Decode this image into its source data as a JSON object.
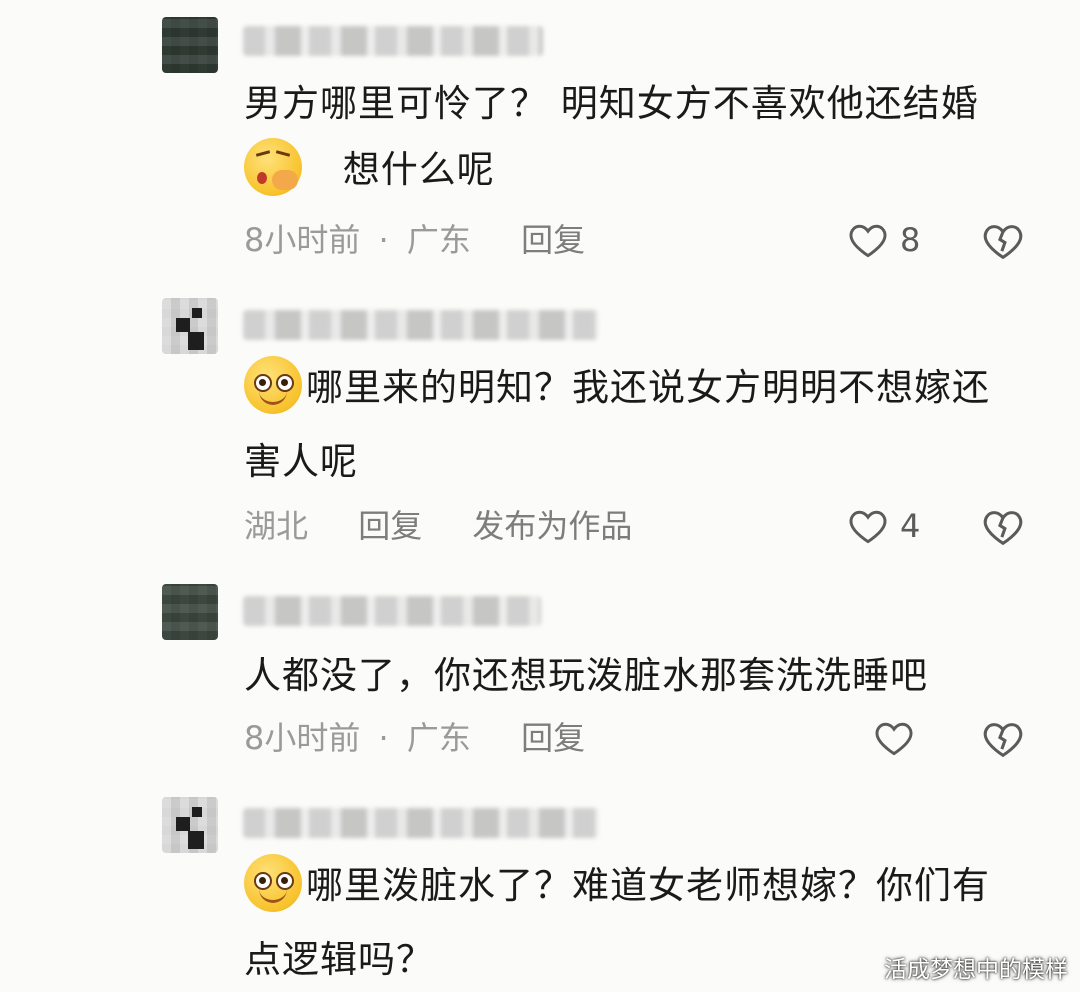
{
  "comments": [
    {
      "lines": [
        "男方哪里可怜了？ 明知女方不喜欢他还结婚",
        "想什么呢"
      ],
      "emoji_line2": "thinking-face-emoji",
      "time": "8小时前",
      "location": "广东",
      "separator": "·",
      "reply": "回复",
      "likes": "8"
    },
    {
      "lines": [
        "哪里来的明知？我还说女方明明不想嫁还",
        "害人呢"
      ],
      "emoji_line1": "smiling-face-emoji",
      "location": "湖北",
      "reply": "回复",
      "publish": "发布为作品",
      "likes": "4"
    },
    {
      "lines": [
        "人都没了，你还想玩泼脏水那套洗洗睡吧"
      ],
      "time": "8小时前",
      "location": "广东",
      "separator": "·",
      "reply": "回复",
      "likes": ""
    },
    {
      "lines": [
        "哪里泼脏水了？难道女老师想嫁？你们有",
        "点逻辑吗？"
      ],
      "emoji_line1": "smiling-face-emoji"
    }
  ],
  "watermark": "活成梦想中的模样",
  "colors": {
    "background": "#fbfbf9",
    "text": "#1a1a1a",
    "meta": "#9a9a9a",
    "icon": "#5b5b5b"
  }
}
